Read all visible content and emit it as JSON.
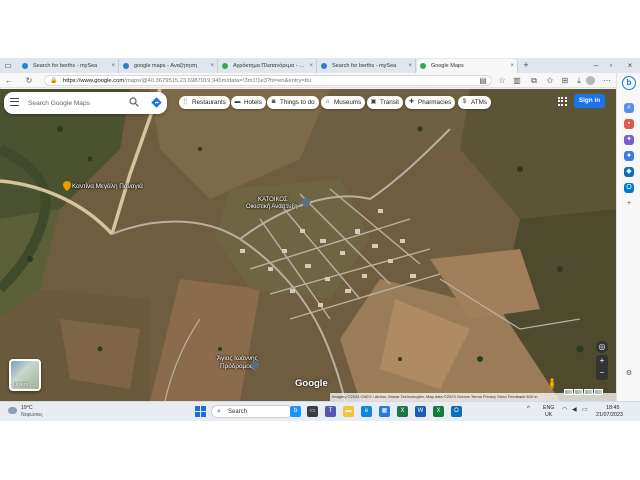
{
  "tabs": [
    {
      "title": "Search for berths - mySea",
      "favicon_color": "#2f7bd6",
      "active": false
    },
    {
      "title": "google maps - Αναζήτηση",
      "favicon_color": "#2f7bd6",
      "active": false
    },
    {
      "title": "Αγρόκτημα Πλατανόρεμα - Χάρτ",
      "favicon_color": "#34a853",
      "active": false
    },
    {
      "title": "Search for berths - mySea",
      "favicon_color": "#2f7bd6",
      "active": false
    },
    {
      "title": "Google Maps",
      "favicon_color": "#34a853",
      "active": true
    }
  ],
  "address_bar": {
    "url_host": "https://www.google.com",
    "url_rest": "/maps/@40.3679515,23.6987919,945m/data=!3m1!1e3?hl=en&entry=ttu"
  },
  "map": {
    "search_placeholder": "Search Google Maps",
    "chips": [
      {
        "label": "Restaurants",
        "icon": "fork-knife-icon"
      },
      {
        "label": "Hotels",
        "icon": "bed-icon"
      },
      {
        "label": "Things to do",
        "icon": "camera-icon"
      },
      {
        "label": "Museums",
        "icon": "museum-icon"
      },
      {
        "label": "Transit",
        "icon": "train-icon"
      },
      {
        "label": "Pharmacies",
        "icon": "pharmacy-icon"
      },
      {
        "label": "ATMs",
        "icon": "atm-icon"
      }
    ],
    "signin_label": "Sign in",
    "places": [
      {
        "label": "Καντίνα Μεγάλη Παναγιά"
      },
      {
        "label": "ΚΑΤΟΙΚΟΣ"
      },
      {
        "label": "Οικιστική Αναπτυξη"
      },
      {
        "label": "Άγιος Ιωάννης"
      },
      {
        "label": "Πρόδρομος"
      }
    ],
    "layers_label": "Layers",
    "logo_text": "Google",
    "attribution": "Imagery ©2023 CNES / Airbus, Maxar Technologies, Map data ©2023   Greece   Terms   Privacy   Send Feedback   500 m"
  },
  "taskbar": {
    "weather_temp": "19°C",
    "weather_desc": "Νεφώσεις",
    "search_label": "Search",
    "lang_line1": "ENG",
    "lang_line2": "UK",
    "time": "18:45",
    "date": "21/07/2023"
  }
}
